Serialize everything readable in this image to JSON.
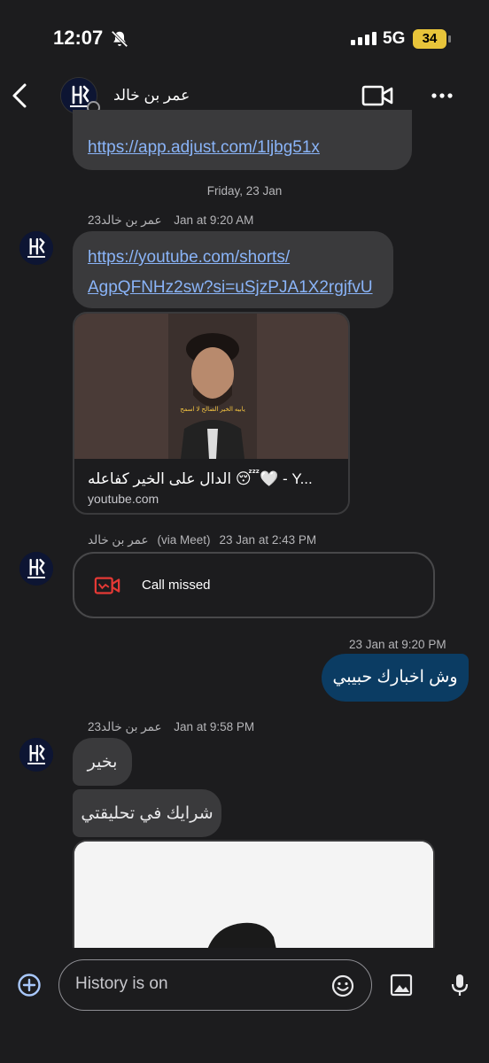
{
  "status_bar": {
    "time": "12:07",
    "network": "5G",
    "battery": "34"
  },
  "header": {
    "contact_name": "عمر بن خالد"
  },
  "messages": {
    "link_prev": "https://app.adjust.com/1ljbg51x",
    "date_divider": "Friday, 23 Jan",
    "group1": {
      "sender": "عمر بن خالد",
      "time": "23 Jan at 9:20 AM"
    },
    "yt_link_line1": "https://youtube.com/shorts/",
    "yt_link_line2": "AgpQFNHz2sw?si=uSjzPJA1X2rgjfvU",
    "preview": {
      "overlay_text": "يابيه الخير الصالح لا اسمح",
      "title": "الدال على الخير كفاعله 😴🤍 - Y...",
      "domain": "youtube.com"
    },
    "group2": {
      "sender": "عمر بن خالد",
      "via": "(via Meet)",
      "time": "23 Jan at 2:43 PM"
    },
    "call_missed": "Call missed",
    "outgoing": {
      "time": "23 Jan at 9:20 PM",
      "text": "وش اخبارك حبيبي"
    },
    "group3": {
      "sender": "عمر بن خالد",
      "time": "23 Jan at 9:58 PM"
    },
    "reply1": "بخير",
    "reply2": "شرايك في تحليقتي"
  },
  "composer": {
    "placeholder": "History is on"
  },
  "colors": {
    "background": "#1c1c1e",
    "incoming": "#3a3a3c",
    "outgoing": "#0b3c63",
    "link": "#8ab4f8",
    "missed": "#e53935"
  }
}
